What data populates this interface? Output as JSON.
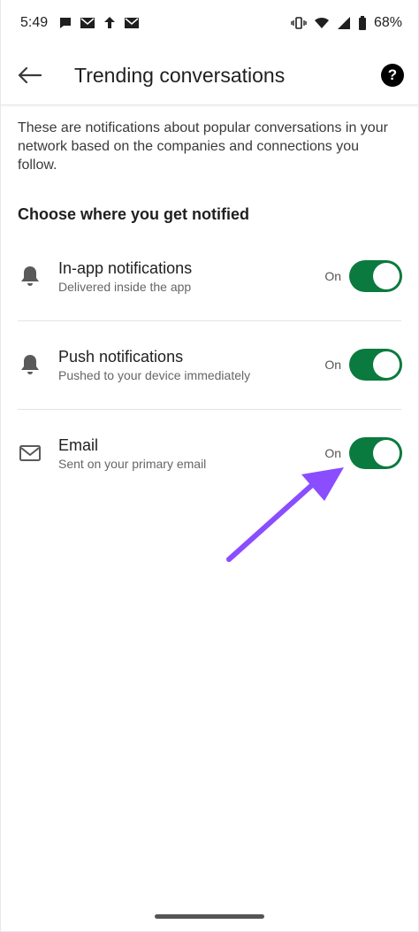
{
  "status_bar": {
    "time": "5:49",
    "battery_percent": "68%",
    "icons_left": [
      "chat-bubble-icon",
      "mail-icon",
      "upload-icon",
      "mail-icon"
    ],
    "icons_right": [
      "vibrate-icon",
      "wifi-icon",
      "signal-icon",
      "battery-icon"
    ]
  },
  "app_bar": {
    "title": "Trending conversations",
    "back_icon": "arrow-left-icon",
    "help_icon": "help-icon",
    "help_glyph": "?"
  },
  "description": "These are notifications about popular conversations in your network based on the companies and connections you follow.",
  "section_heading": "Choose where you get notified",
  "settings": [
    {
      "icon": "bell-icon",
      "title": "In-app notifications",
      "subtitle": "Delivered inside the app",
      "state": "On",
      "enabled": true
    },
    {
      "icon": "bell-icon",
      "title": "Push notifications",
      "subtitle": "Pushed to your device immediately",
      "state": "On",
      "enabled": true
    },
    {
      "icon": "envelope-icon",
      "title": "Email",
      "subtitle": "Sent on your primary email",
      "state": "On",
      "enabled": true
    }
  ],
  "colors": {
    "toggle_on": "#0b7a3e",
    "annotation_arrow": "#8a4dff"
  }
}
